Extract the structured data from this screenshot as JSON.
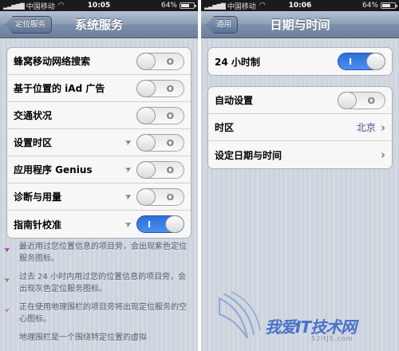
{
  "left_screen": {
    "status": {
      "carrier": "中国移动",
      "time": "10:05",
      "battery": "64%"
    },
    "nav": {
      "back_label": "定位服务",
      "title": "系统服务"
    },
    "rows": [
      {
        "label": "蜂窝移动网络搜索",
        "location_icon": false,
        "toggle": "off"
      },
      {
        "label": "基于位置的 iAd 广告",
        "location_icon": false,
        "toggle": "off"
      },
      {
        "label": "交通状况",
        "location_icon": false,
        "toggle": "off"
      },
      {
        "label": "设置时区",
        "location_icon": true,
        "toggle": "off"
      },
      {
        "label": "应用程序 Genius",
        "location_icon": true,
        "toggle": "off"
      },
      {
        "label": "诊断与用量",
        "location_icon": true,
        "toggle": "off"
      },
      {
        "label": "指南针校准",
        "location_icon": true,
        "toggle": "on"
      }
    ],
    "notes": [
      {
        "icon": "purple-location-arrow-icon",
        "text": "最近用过您位置信息的项目旁，会出现紫色定位服务图标。"
      },
      {
        "icon": "gray-location-arrow-icon",
        "text": "过去 24 小时内用过您的位置信息的项目旁，会出现灰色定位服务图标。"
      },
      {
        "icon": "outline-location-arrow-icon",
        "text": "正在使用地理围栏的项目旁将出现定位服务的空心图标。"
      },
      {
        "icon": "",
        "text": "地理围栏是一个围绕特定位置的虚拟"
      }
    ]
  },
  "right_screen": {
    "status": {
      "carrier": "中国移动",
      "time": "10:06",
      "battery": "64%"
    },
    "nav": {
      "back_label": "通用",
      "title": "日期与时间"
    },
    "group1": [
      {
        "label": "24 小时制",
        "toggle": "on"
      }
    ],
    "group2": [
      {
        "label": "自动设置",
        "toggle": "off"
      },
      {
        "label": "时区",
        "value": "北京"
      },
      {
        "label": "设定日期与时间",
        "value": ""
      }
    ]
  },
  "toggle_text": {
    "off": "O",
    "on": "I"
  },
  "colors": {
    "toggle_on": "#3a7fe6",
    "value_blue": "#385487",
    "note_purple": "#9b3fb5",
    "nav_bar": "#8596b0"
  },
  "watermark": {
    "text": "我爱IT技术网",
    "url": "52itJS.com"
  }
}
